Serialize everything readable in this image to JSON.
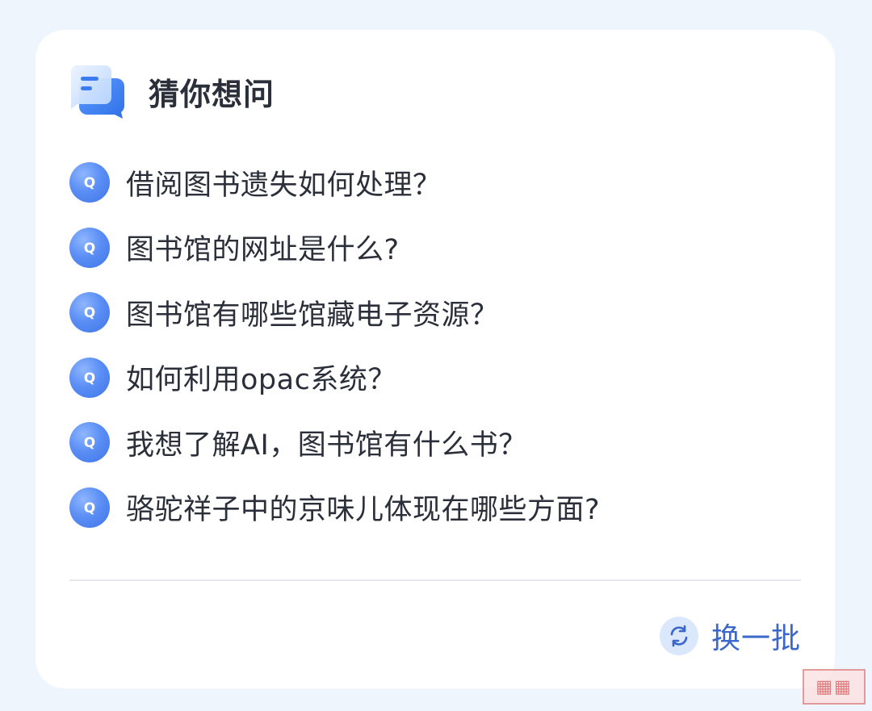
{
  "header": {
    "title": "猜你想问",
    "icon": "chat-bubbles-icon"
  },
  "questions": [
    {
      "badge": "Q",
      "text": "借阅图书遗失如何处理？"
    },
    {
      "badge": "Q",
      "text": "图书馆的网址是什么?"
    },
    {
      "badge": "Q",
      "text": "图书馆有哪些馆藏电子资源？"
    },
    {
      "badge": "Q",
      "text": "如何利用opac系统？"
    },
    {
      "badge": "Q",
      "text": "我想了解AI，图书馆有什么书？"
    },
    {
      "badge": "Q",
      "text": "骆驼祥子中的京味儿体现在哪些方面?"
    }
  ],
  "footer": {
    "refresh_label": "换一批",
    "refresh_icon": "refresh-icon"
  },
  "colors": {
    "accent": "#3a67c9",
    "badge": "#5b8ff5",
    "background": "#eef5fd"
  }
}
